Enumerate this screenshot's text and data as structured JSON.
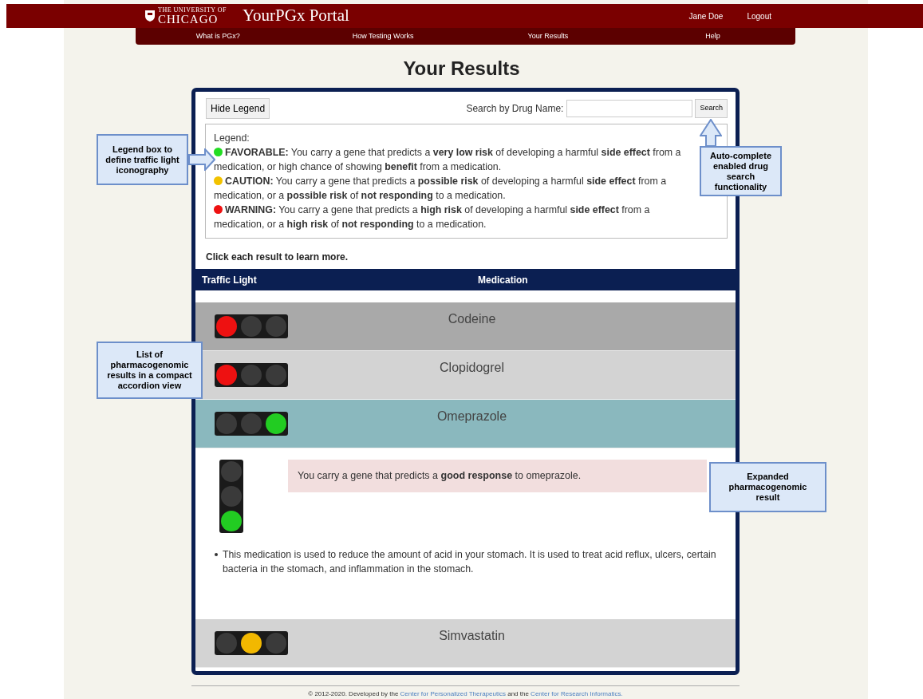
{
  "header": {
    "logo_small": "THE UNIVERSITY OF",
    "logo_large": "CHICAGO",
    "title": "YourPGx Portal",
    "user": "Jane Doe",
    "logout": "Logout"
  },
  "nav": [
    {
      "label": "What is PGx?"
    },
    {
      "label": "How Testing Works"
    },
    {
      "label": "Your Results"
    },
    {
      "label": "Help"
    }
  ],
  "page_title": "Your Results",
  "toolbar": {
    "hide_legend": "Hide Legend",
    "search_label": "Search by Drug Name:",
    "search_button": "Search"
  },
  "legend": {
    "title": "Legend:",
    "items": [
      {
        "color": "#22dd22",
        "label": "FAVORABLE:",
        "text": "You carry a gene that predicts a **very low risk** of developing a harmful **side effect** from a medication, or high chance of showing **benefit** from a medication."
      },
      {
        "color": "#f2c200",
        "label": "CAUTION:",
        "text": "You carry a gene that predicts a **possible risk** of developing a harmful **side effect** from a medication, or a **possible risk** of **not responding** to a medication."
      },
      {
        "color": "#ee1111",
        "label": "WARNING:",
        "text": "You carry a gene that predicts a **high risk** of developing a harmful **side effect** from a medication, or a **high risk** of **not responding** to a medication."
      }
    ]
  },
  "hint": "Click each result to learn more.",
  "table": {
    "columns": [
      "Traffic Light",
      "Medication"
    ],
    "rows": [
      {
        "medication": "Codeine",
        "color": "#ee1111",
        "hovered": true,
        "expanded": false
      },
      {
        "medication": "Clopidogrel",
        "color": "#ee1111",
        "hovered": false,
        "expanded": false
      },
      {
        "medication": "Omeprazole",
        "color": "#22cc22",
        "hovered": false,
        "expanded": true,
        "detail": {
          "alert": "You carry a gene that predicts a **good response** to omeprazole.",
          "description": "This medication is used to reduce the amount of acid in your stomach. It is used to treat acid reflux, ulcers, certain bacteria in the stomach, and inflammation in the stomach."
        }
      },
      {
        "medication": "Simvastatin",
        "color": "#f2b800",
        "hovered": false,
        "expanded": false
      }
    ]
  },
  "footer": {
    "prefix": "© 2012-2020. Developed by the",
    "link1": "Center for Personalized Therapeutics",
    "middle": "and the",
    "link2": "Center for Research Informatics."
  },
  "callouts": [
    {
      "kind": "right",
      "text": "Legend box to define traffic light iconography"
    },
    {
      "kind": "up",
      "text": "Auto-complete enabled drug search functionality"
    },
    {
      "kind": "none",
      "text": "List of pharmacogenomic results in a compact accordion view"
    },
    {
      "kind": "none",
      "text": "Expanded pharmacogenomic result"
    }
  ]
}
